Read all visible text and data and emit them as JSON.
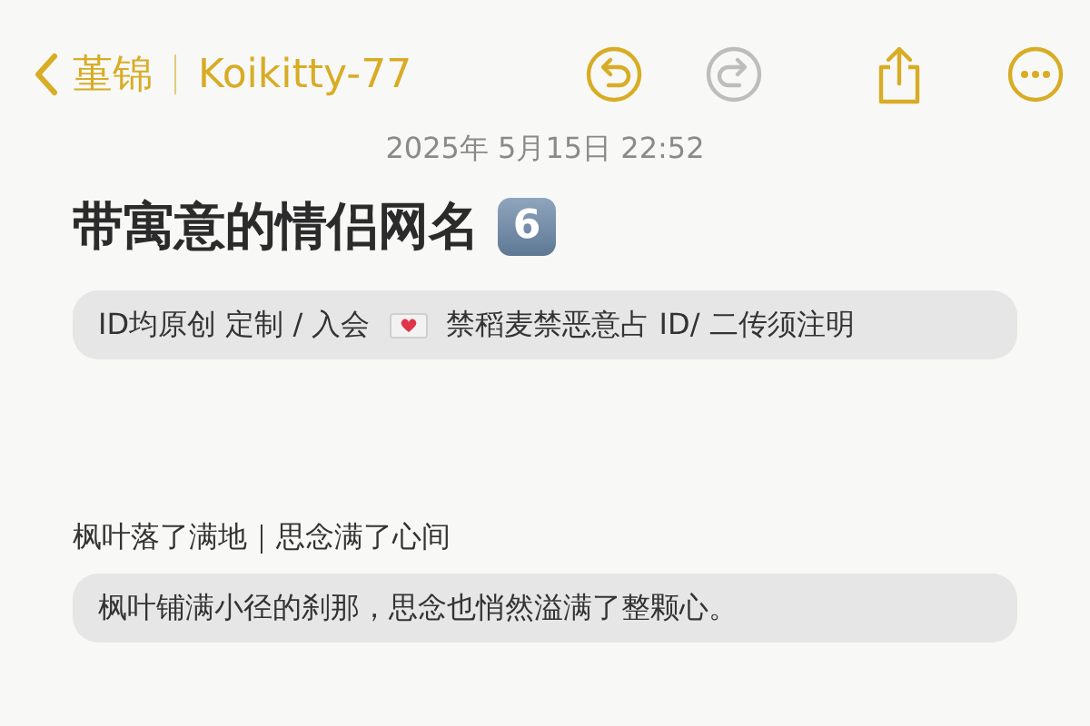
{
  "nav": {
    "back_label": "堇锦",
    "folder": "Koikitty-77",
    "undo": {
      "disabled": false
    },
    "redo": {
      "disabled": true
    }
  },
  "date": "2025年 5月15日 22:52",
  "title": {
    "text": "带寓意的情侣网名",
    "badge": "6"
  },
  "blocks": [
    {
      "kind": "pill",
      "parts": [
        {
          "kind": "text",
          "text": "ID均原创  定制 / 入会"
        },
        {
          "kind": "envelope"
        },
        {
          "kind": "text",
          "text": "禁稻麦禁恶意占 ID/ 二传须注明"
        }
      ]
    },
    {
      "kind": "gap"
    },
    {
      "kind": "line",
      "text": "枫叶落了满地｜思念满了心间"
    },
    {
      "kind": "pill",
      "parts": [
        {
          "kind": "text",
          "text": "枫叶铺满小径的刹那，思念也悄然溢满了整颗心。"
        }
      ]
    }
  ]
}
